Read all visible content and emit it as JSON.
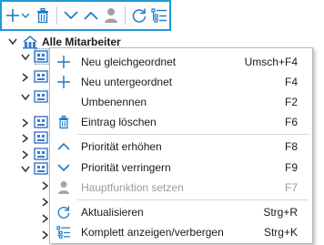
{
  "toolbar": {
    "buttons": [
      {
        "icon": "plus-dropdown-icon"
      },
      {
        "icon": "trash-icon"
      },
      {
        "icon": "chevron-down-icon"
      },
      {
        "icon": "chevron-up-icon"
      },
      {
        "icon": "person-icon"
      },
      {
        "icon": "refresh-icon"
      },
      {
        "icon": "expand-collapse-list-icon"
      }
    ],
    "accent_color": "#1e9ad6"
  },
  "tree": {
    "root_label": "Alle Mitarbeiter",
    "icon_color": "#3c78c8"
  },
  "context_menu": {
    "items": [
      {
        "label": "Neu gleichgeordnet",
        "shortcut": "Umsch+F4",
        "icon": "plus-icon",
        "enabled": true
      },
      {
        "label": "Neu untergeordnet",
        "shortcut": "F4",
        "icon": "plus-icon",
        "enabled": true
      },
      {
        "label": "Umbenennen",
        "shortcut": "F2",
        "icon": "",
        "enabled": true
      },
      {
        "label": "Eintrag löschen",
        "shortcut": "F6",
        "icon": "trash-icon",
        "enabled": true
      },
      {
        "label": "Priorität erhöhen",
        "shortcut": "F8",
        "icon": "chevron-up-icon",
        "enabled": true
      },
      {
        "label": "Priorität verringern",
        "shortcut": "F9",
        "icon": "chevron-down-icon",
        "enabled": true
      },
      {
        "label": "Hauptfunktion setzen",
        "shortcut": "F7",
        "icon": "person-icon",
        "enabled": false
      },
      {
        "label": "Aktualisieren",
        "shortcut": "Strg+R",
        "icon": "refresh-icon",
        "enabled": true
      },
      {
        "label": "Komplett anzeigen/verbergen",
        "shortcut": "Strg+K",
        "icon": "expand-collapse-list-icon",
        "enabled": true
      }
    ],
    "icon_color": "#1e7bc4",
    "disabled_color": "#9a9a9a"
  }
}
